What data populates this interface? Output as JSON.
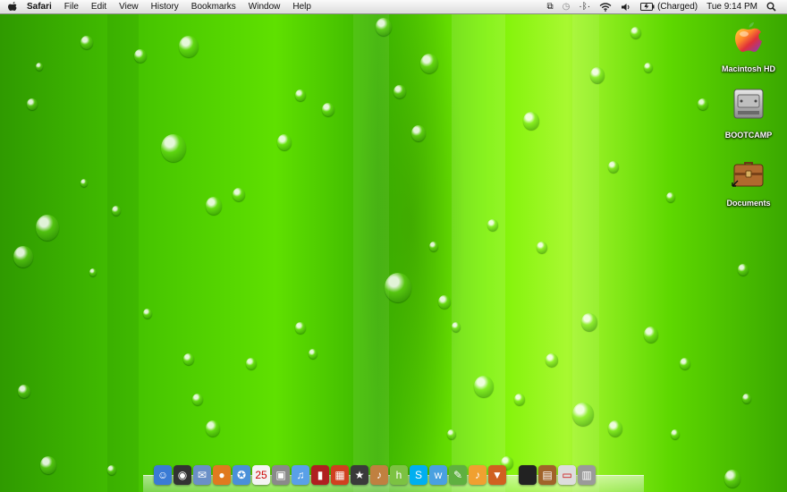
{
  "menubar": {
    "app_name": "Safari",
    "menus": [
      "File",
      "Edit",
      "View",
      "History",
      "Bookmarks",
      "Window",
      "Help"
    ],
    "status": {
      "battery_text": "(Charged)",
      "clock": "Tue 9:14 PM"
    },
    "status_icons": [
      "spaces-icon",
      "time-machine-icon",
      "bluetooth-icon",
      "wifi-icon",
      "volume-icon",
      "battery-icon",
      "spotlight-icon"
    ]
  },
  "desktop": {
    "icons": [
      {
        "label": "Macintosh HD",
        "icon": "apple-drive-icon"
      },
      {
        "label": "BOOTCAMP",
        "icon": "hard-drive-icon"
      },
      {
        "label": "Documents",
        "icon": "briefcase-icon"
      }
    ]
  },
  "dock": {
    "items": [
      {
        "name": "finder-icon",
        "color": "#3a7bd5",
        "glyph": "☺"
      },
      {
        "name": "dashboard-icon",
        "color": "#333333",
        "glyph": "◉"
      },
      {
        "name": "mail-icon",
        "color": "#6a8fc7",
        "glyph": "✉"
      },
      {
        "name": "firefox-icon",
        "color": "#e07a1f",
        "glyph": "●"
      },
      {
        "name": "safari-icon",
        "color": "#4a90d9",
        "glyph": "✪"
      },
      {
        "name": "ical-icon",
        "color": "#f4f4f4",
        "glyph": "25"
      },
      {
        "name": "photo-icon",
        "color": "#8a8a8a",
        "glyph": "▣"
      },
      {
        "name": "itunes-icon",
        "color": "#5aa0e8",
        "glyph": "♫"
      },
      {
        "name": "iphoto-icon",
        "color": "#b02020",
        "glyph": "▮"
      },
      {
        "name": "photo-booth-icon",
        "color": "#d04020",
        "glyph": "▦"
      },
      {
        "name": "imovie-icon",
        "color": "#3a3a3a",
        "glyph": "★"
      },
      {
        "name": "garageband-icon",
        "color": "#c08040",
        "glyph": "♪"
      },
      {
        "name": "hulu-icon",
        "color": "#7cc242",
        "glyph": "h"
      },
      {
        "name": "skype-icon",
        "color": "#00aff0",
        "glyph": "S"
      },
      {
        "name": "chat-icon",
        "color": "#4aa0e0",
        "glyph": "w"
      },
      {
        "name": "ichat-icon",
        "color": "#5fb040",
        "glyph": "✎"
      },
      {
        "name": "keyboard-icon",
        "color": "#f0a030",
        "glyph": "♪"
      },
      {
        "name": "presentation-icon",
        "color": "#d06020",
        "glyph": "▼"
      },
      {
        "name": "macbook-icon",
        "color": "#222222",
        "glyph": ""
      },
      {
        "name": "documents-stack-icon",
        "color": "#a0622a",
        "glyph": "▤"
      },
      {
        "name": "downloads-stack-icon",
        "color": "#dddddd",
        "glyph": "▭"
      },
      {
        "name": "trash-icon",
        "color": "#9a9a9a",
        "glyph": "▥"
      }
    ]
  },
  "colors": {
    "wallpaper_primary": "#46c400",
    "wallpaper_highlight": "#a8f830"
  }
}
